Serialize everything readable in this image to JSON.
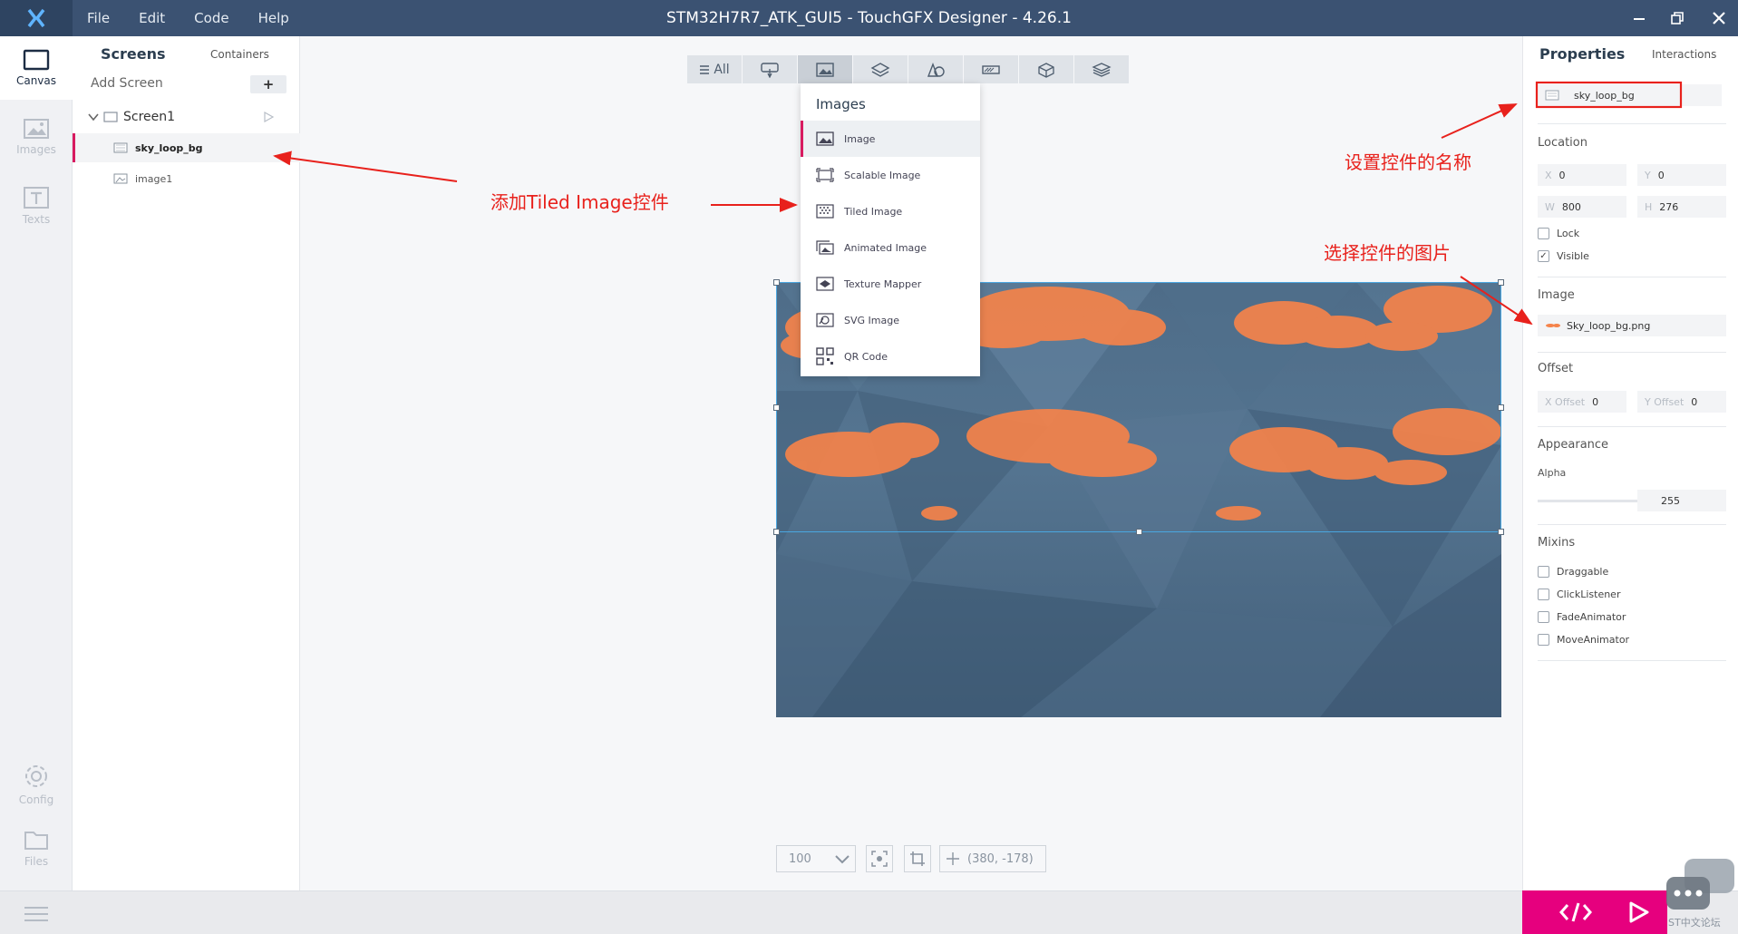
{
  "window": {
    "title": "STM32H7R7_ATK_GUI5 - TouchGFX Designer - 4.26.1",
    "menus": [
      "File",
      "Edit",
      "Code",
      "Help"
    ]
  },
  "left_rail": {
    "canvas": "Canvas",
    "images": "Images",
    "texts": "Texts",
    "config": "Config",
    "files": "Files"
  },
  "screens_panel": {
    "tab_screens": "Screens",
    "tab_containers": "Containers",
    "add_screen": "Add Screen",
    "add_symbol": "+",
    "tree": [
      {
        "label": "Screen1"
      },
      {
        "label": "sky_loop_bg"
      },
      {
        "label": "image1"
      }
    ]
  },
  "toolbar": {
    "all_label": "All"
  },
  "images_dropdown": {
    "header": "Images",
    "items": [
      "Image",
      "Scalable Image",
      "Tiled Image",
      "Animated Image",
      "Texture Mapper",
      "SVG Image",
      "QR Code"
    ]
  },
  "canvas_controls": {
    "zoom": "100",
    "coords": "(380, -178)"
  },
  "properties": {
    "tab_properties": "Properties",
    "tab_interactions": "Interactions",
    "name": "sky_loop_bg",
    "location_label": "Location",
    "x_key": "X",
    "x_val": "0",
    "y_key": "Y",
    "y_val": "0",
    "w_key": "W",
    "w_val": "800",
    "h_key": "H",
    "h_val": "276",
    "lock": "Lock",
    "visible": "Visible",
    "image_label": "Image",
    "image_file": "Sky_loop_bg.png",
    "offset_label": "Offset",
    "xoffset_key": "X Offset",
    "xoffset_val": "0",
    "yoffset_key": "Y Offset",
    "yoffset_val": "0",
    "appearance_label": "Appearance",
    "alpha_label": "Alpha",
    "alpha_val": "255",
    "alpha_level": 255,
    "mixins_label": "Mixins",
    "mixins": [
      "Draggable",
      "ClickListener",
      "FadeAnimator",
      "MoveAnimator"
    ]
  },
  "annotations": {
    "add_tiled": "添加Tiled Image控件",
    "set_name": "设置控件的名称",
    "select_image": "选择控件的图片",
    "color": "#e8211c"
  },
  "watermark": "ST中文论坛",
  "colors": {
    "accent": "#e6007e",
    "titlebar": "#3b5272",
    "selection": "#4aa6e0"
  }
}
